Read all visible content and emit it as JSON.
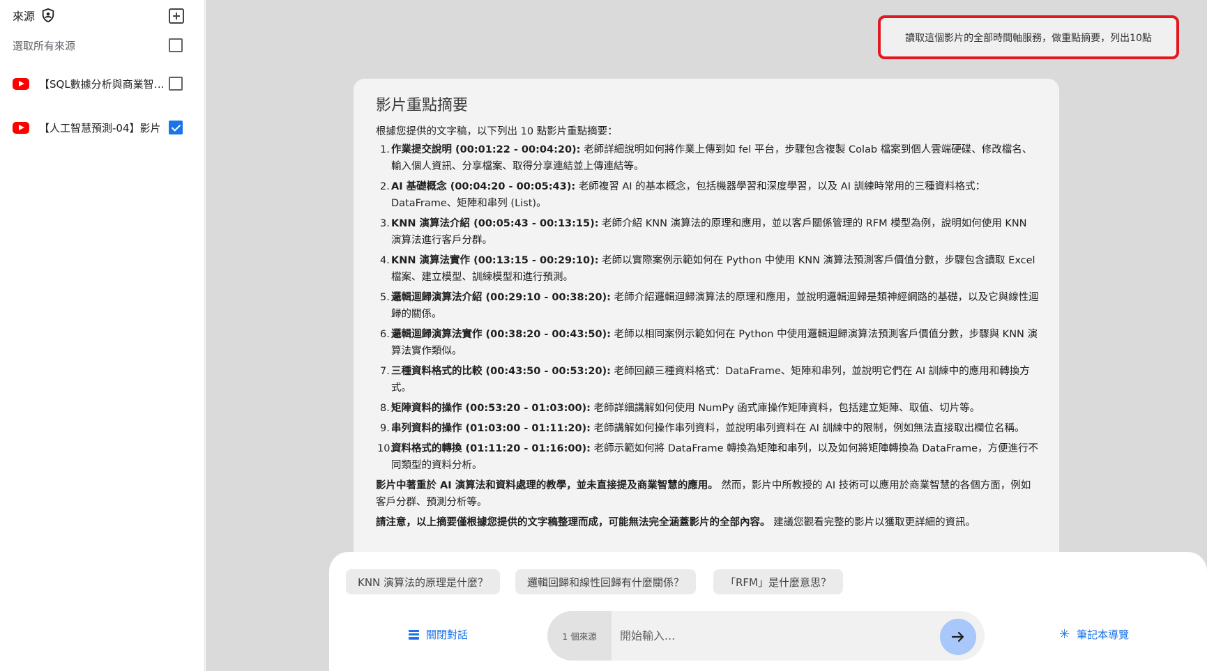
{
  "sidebar": {
    "title": "來源",
    "select_all": "選取所有來源",
    "sources": [
      {
        "name": "【SQL數據分析與商業智慧】影片",
        "checked": false
      },
      {
        "name": "【人工智慧預測-04】影片",
        "checked": true
      }
    ]
  },
  "user_message": "讀取這個影片的全部時間軸服務，做重點摘要，列出10點",
  "summary": {
    "title": "影片重點摘要",
    "intro": "根據您提供的文字稿，以下列出 10 點影片重點摘要：",
    "items": [
      {
        "num": "1.",
        "head": "作業提交說明 (00:01:22 - 00:04:20):",
        "body": " 老師詳細說明如何將作業上傳到如 fel 平台，步驟包含複製 Colab 檔案到個人雲端硬碟、修改檔名、輸入個人資訊、分享檔案、取得分享連結並上傳連結等。"
      },
      {
        "num": "2.",
        "head": "AI 基礎概念 (00:04:20 - 00:05:43):",
        "body": " 老師複習 AI 的基本概念，包括機器學習和深度學習，以及 AI 訓練時常用的三種資料格式：DataFrame、矩陣和串列 (List)。"
      },
      {
        "num": "3.",
        "head": "KNN 演算法介紹 (00:05:43 - 00:13:15):",
        "body": " 老師介紹 KNN 演算法的原理和應用，並以客戶關係管理的 RFM 模型為例，說明如何使用 KNN 演算法進行客戶分群。"
      },
      {
        "num": "4.",
        "head": "KNN 演算法實作 (00:13:15 - 00:29:10):",
        "body": " 老師以實際案例示範如何在 Python 中使用 KNN 演算法預測客戶價值分數，步驟包含讀取 Excel 檔案、建立模型、訓練模型和進行預測。"
      },
      {
        "num": "5.",
        "head": "邏輯迴歸演算法介紹 (00:29:10 - 00:38:20):",
        "body": " 老師介紹邏輯迴歸演算法的原理和應用，並說明邏輯迴歸是類神經網路的基礎，以及它與線性迴歸的關係。"
      },
      {
        "num": "6.",
        "head": "邏輯迴歸演算法實作 (00:38:20 - 00:43:50):",
        "body": " 老師以相同案例示範如何在 Python 中使用邏輯迴歸演算法預測客戶價值分數，步驟與 KNN 演算法實作類似。"
      },
      {
        "num": "7.",
        "head": "三種資料格式的比較 (00:43:50 - 00:53:20):",
        "body": " 老師回顧三種資料格式：DataFrame、矩陣和串列，並說明它們在 AI 訓練中的應用和轉換方式。"
      },
      {
        "num": "8.",
        "head": "矩陣資料的操作 (00:53:20 - 01:03:00):",
        "body": " 老師詳細講解如何使用 NumPy 函式庫操作矩陣資料，包括建立矩陣、取值、切片等。"
      },
      {
        "num": "9.",
        "head": "串列資料的操作 (01:03:00 - 01:11:20):",
        "body": " 老師講解如何操作串列資料，並說明串列資料在 AI 訓練中的限制，例如無法直接取出欄位名稱。"
      },
      {
        "num": "10.",
        "head": "資料格式的轉換 (01:11:20 - 01:16:00):",
        "body": " 老師示範如何將 DataFrame 轉換為矩陣和串列，以及如何將矩陣轉換為 DataFrame，方便進行不同類型的資料分析。"
      }
    ],
    "note1_bold": "影片中著重於 AI 演算法和資料處理的教學，並未直接提及商業智慧的應用。",
    "note1_rest": " 然而，影片中所教授的 AI 技術可以應用於商業智慧的各個方面，例如客戶分群、預測分析等。",
    "note2_bold": "請注意，以上摘要僅根據您提供的文字稿整理而成，可能無法完全涵蓋影片的全部內容。",
    "note2_rest": " 建議您觀看完整的影片以獲取更詳細的資訊。"
  },
  "suggestions": [
    "KNN 演算法的原理是什麼？",
    "邏輯回歸和線性回歸有什麼關係？",
    "「RFM」是什麼意思？"
  ],
  "bottom": {
    "close_chat": "關閉對話",
    "source_count": "1 個來源",
    "input_placeholder": "開始輸入...",
    "notebook_guide": "筆記本導覽"
  }
}
